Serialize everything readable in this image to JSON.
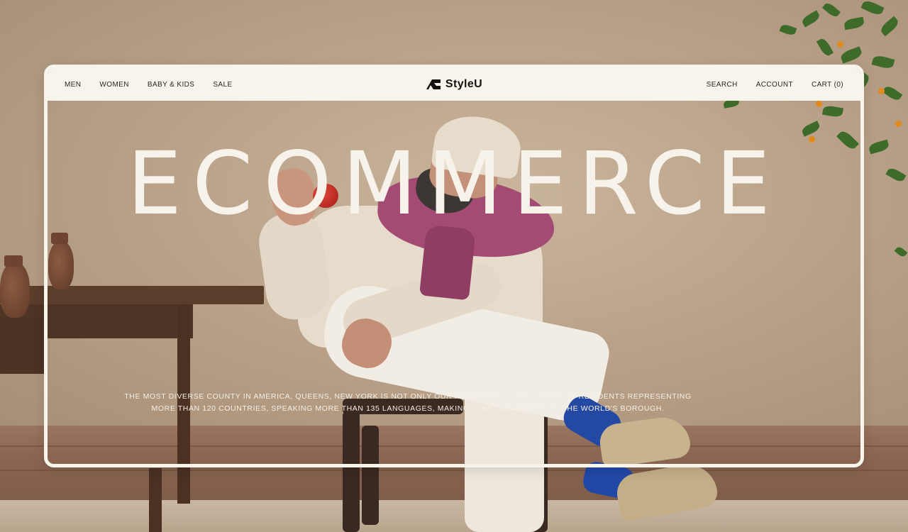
{
  "nav": {
    "left": [
      "MEN",
      "WOMEN",
      "BABY & KIDS",
      "SALE"
    ],
    "brand": "StyleU",
    "right": [
      "SEARCH",
      "ACCOUNT",
      "CART (0)"
    ]
  },
  "hero": {
    "title": "ECOMMERCE",
    "body": "THE MOST DIVERSE COUNTY IN AMERICA, QUEENS, NEW YORK IS NOT ONLY OUR HOMETOWN, ALSO A HOME TO RESIDENTS REPRESENTING MORE THAN 120 COUNTRIES, SPEAKING MORE THAN 135 LANGUAGES, MAKING IT BETTER KNOWN AS THE WORLD'S BOROUGH."
  },
  "colors": {
    "wall": "#baa38a",
    "nav_bg": "#f7f4ec",
    "title": "#f7f3ea",
    "scarf": "#a34b72",
    "socks": "#2449a3"
  },
  "icons": {
    "brand_logo": "stylized-s-logo-icon"
  }
}
